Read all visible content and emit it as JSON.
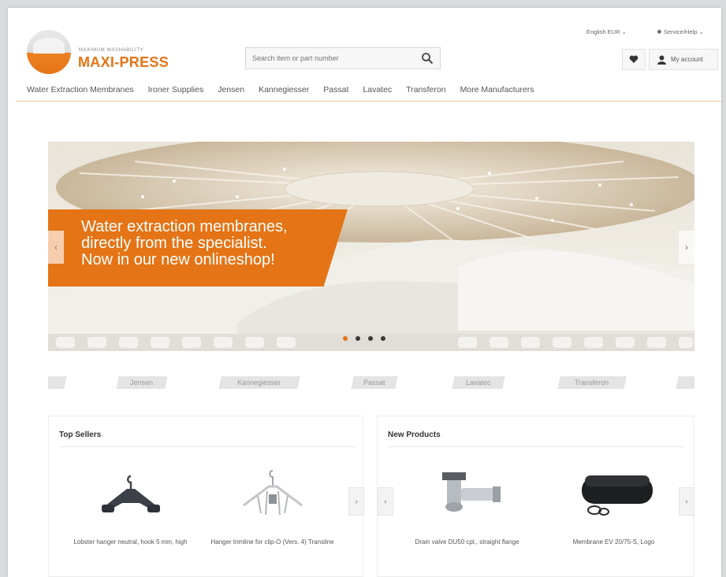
{
  "header": {
    "logo_tagline": "MAXIMUM WASHABILITY",
    "logo_name": "MAXI-PRESS",
    "language": "English EUR",
    "help": "Service/Help",
    "search_placeholder": "Search item or part number",
    "account_label": "My account"
  },
  "nav": {
    "items": [
      {
        "label": "Water Extraction Membranes"
      },
      {
        "label": "Ironer Supplies"
      },
      {
        "label": "Jensen"
      },
      {
        "label": "Kannegiesser"
      },
      {
        "label": "Passat"
      },
      {
        "label": "Lavatec"
      },
      {
        "label": "Transferon"
      },
      {
        "label": "More Manufacturers"
      }
    ]
  },
  "slider": {
    "lines": [
      "Water extraction membranes,",
      "directly from the specialist.",
      "Now in our new onlineshop!"
    ],
    "slide_count": 4,
    "active_slide": 0
  },
  "manufacturers": [
    "Jensen",
    "Kannegiesser",
    "Passat",
    "Lavatec",
    "Transferon"
  ],
  "top_sellers": {
    "title": "Top Sellers",
    "products": [
      {
        "name": "Lobster hanger neutral, hook 5 mm, high"
      },
      {
        "name": "Hanger trimline for clip-O (Vers. 4) Transline"
      }
    ]
  },
  "new_products": {
    "title": "New Products",
    "products": [
      {
        "name": "Drain valve DU50 cpl., straight flange"
      },
      {
        "name": "Membrane EV 20/75-S, Logo"
      }
    ]
  },
  "colors": {
    "accent": "#e47416",
    "nav_text": "#555555"
  }
}
